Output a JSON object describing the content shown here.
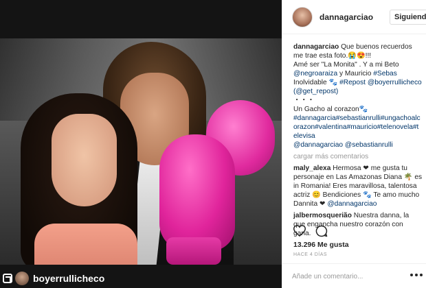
{
  "post": {
    "repost_username": "boyerrullicheco"
  },
  "header": {
    "username": "dannagarciao",
    "follow_label": "Siguiendo"
  },
  "caption": {
    "username": "dannagarciao",
    "line1": " Que buenos recuerdos me trae esta foto.😭😍!!!",
    "line2a": "Amé ser \"La Monita\" . Y a mi Beto ",
    "mention1": "@negroaraiza",
    "line2b": " y Mauricio ",
    "hashtag1": "#Sebas",
    "line3a": "Inolvidable 🐾 ",
    "hashtag2": "#Repost",
    "line3b": " ",
    "mention2": "@boyerrullicheco",
    "mention3": "(@get_repost)",
    "dots": "・・・",
    "line4": "Un Gacho al corazon🐾",
    "hashtags": "#dannagarcia#sebastianrulli#ungachoalcorazon#valentina#mauricio#telenovela#televisa",
    "mentions_end": "@dannagarciao @sebastianrulli"
  },
  "more_comments_label": "cargar más comentarios",
  "comments": [
    {
      "username": "maly_alexa",
      "text": " Hermosa ❤ me gusta tu personaje en Las Amazonas Diana 🌴 es in Romania! Eres maravillosa, talentosa actriz 😊 Bendiciones 🐾 Te amo mucho Dannita ❤ ",
      "mention": "@dannagarciao"
    },
    {
      "username": "jalbermosquerião",
      "text": " Nuestra danna, la que engancha nuestro corazón con gana."
    }
  ],
  "likes_text": "13.296 Me gusta",
  "time_text": "HACE 4 DÍAS",
  "add_comment_placeholder": "Añade un comentario...",
  "icons": {
    "like": "heart-icon",
    "comment": "comment-icon",
    "options": "more-options-icon",
    "repost": "repost-icon"
  }
}
